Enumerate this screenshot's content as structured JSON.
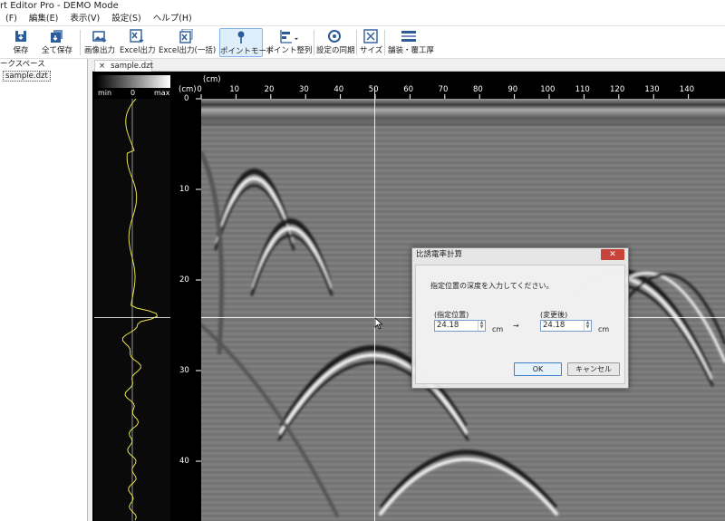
{
  "app": {
    "title": "rt Editor Pro - DEMO Mode"
  },
  "menu": [
    "(F)",
    "編集(E)",
    "表示(V)",
    "設定(S)",
    "ヘルプ(H)"
  ],
  "toolbar": {
    "save": "保存",
    "save_all": "全て保存",
    "image_export": "画像出力",
    "excel_export": "Excel出力",
    "excel_export_batch": "Excel出力(一括)",
    "point_mode": "ポイントモード",
    "point_align": "ポイント整列",
    "sync_settings": "設定の同期",
    "size": "サイズ",
    "pavement": "舗装・覆工厚"
  },
  "workspace": {
    "title": "ークスペース",
    "file": "sample.dzt"
  },
  "tab": {
    "close": "×",
    "label": "sample.dzt"
  },
  "trace_scale": {
    "min": "min",
    "zero": "0",
    "max": "max"
  },
  "axis": {
    "x_unit": "(cm)",
    "y_unit": "(cm)",
    "x_ticks": [
      "0",
      "10",
      "20",
      "30",
      "40",
      "50",
      "60",
      "70",
      "80",
      "90",
      "100",
      "110",
      "120",
      "130",
      "140"
    ],
    "y_ticks": [
      "0",
      "10",
      "20",
      "30",
      "40"
    ]
  },
  "dialog": {
    "title": "比誘電率計算",
    "close": "✕",
    "instruction": "指定位置の深度を入力してください。",
    "specified_label": "(指定位置)",
    "changed_label": "(変更後)",
    "specified_value": "24.18",
    "changed_value": "24.18",
    "unit": "cm",
    "arrow": "→",
    "ok": "OK",
    "cancel": "キャンセル"
  },
  "colors": {
    "trace_line": "#e8e34a",
    "dialog_close": "#c8433a",
    "active_tool": "#dfeefb"
  }
}
